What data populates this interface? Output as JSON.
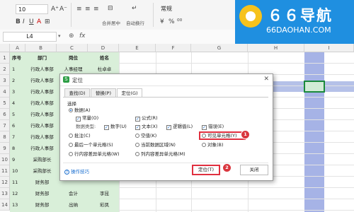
{
  "toolbar": {
    "font_size": "10",
    "font_dropdown": "~",
    "align_labels": [
      "合并居中",
      "自动换行"
    ],
    "format_label": "常规",
    "glyphs": [
      "B",
      "I",
      "U",
      "A",
      "⊞",
      "≡",
      "≡",
      "≡"
    ]
  },
  "watermark": {
    "title": "６６导航",
    "url": "66DAOHAN.COM"
  },
  "formula_bar": {
    "cell_ref": "L4",
    "fx": "fx",
    "dropdown": "▾",
    "zoom": "⊕"
  },
  "sheet": {
    "col_headers": [
      "A",
      "B",
      "C",
      "D",
      "E",
      "F",
      "G",
      "H",
      "I"
    ],
    "row_numbers": [
      "1",
      "2",
      "3",
      "4",
      "5",
      "6",
      "7",
      "8",
      "9",
      "10",
      "11",
      "12",
      "13",
      "14",
      "15"
    ],
    "header_row": [
      "序号",
      "部门",
      "岗位",
      "姓名"
    ],
    "rows": [
      [
        "1",
        "行政人事部",
        "人事经理",
        "杜卓卓"
      ],
      [
        "2",
        "行政人事部",
        "",
        ""
      ],
      [
        "3",
        "行政人事部",
        "",
        ""
      ],
      [
        "4",
        "行政人事部",
        "",
        ""
      ],
      [
        "5",
        "行政人事部",
        "",
        ""
      ],
      [
        "6",
        "行政人事部",
        "",
        ""
      ],
      [
        "7",
        "行政人事部",
        "",
        ""
      ],
      [
        "8",
        "行政人事部",
        "",
        ""
      ],
      [
        "9",
        "采购部长",
        "",
        ""
      ],
      [
        "10",
        "采购部长",
        "",
        ""
      ],
      [
        "11",
        "财务部",
        "",
        ""
      ],
      [
        "12",
        "财务部",
        "会计",
        "李昆"
      ],
      [
        "13",
        "财务部",
        "出纳",
        "彩凤"
      ],
      [
        "14",
        "市场营销部",
        "",
        "贾可伯"
      ]
    ]
  },
  "dialog": {
    "title": "定位",
    "close": "✕",
    "app_icon": "S",
    "tabs": [
      "查找(D)",
      "替换(P)",
      "定位(G)"
    ],
    "active_tab": 2,
    "select_label": "选择",
    "options": {
      "data": "数据(A)",
      "constant": "常量(O)",
      "formula": "公式(R)",
      "data_type": "数据类型:",
      "number": "数字(U)",
      "text": "文本(X)",
      "logic": "逻辑值(L)",
      "error": "错误(E)",
      "comment": "批注(C)",
      "blank": "空值(K)",
      "visible_cells": "可见单元格(Y)",
      "last_cell": "最后一个单元格(S)",
      "current_region": "当前数据区域(N)",
      "object": "对象(B)",
      "row_diff": "行内容差异单元格(W)",
      "col_diff": "列内容差异单元格(M)"
    },
    "tips": "操作技巧",
    "buttons": {
      "locate": "定位(T)",
      "close": "关闭"
    },
    "step_badges": [
      "1",
      "2"
    ]
  },
  "colors": {
    "highlight_red": "#e0303f",
    "selection_blue": "#a6b3e6",
    "active_green": "#1b8a3c",
    "cell_green": "#d9efd9"
  }
}
